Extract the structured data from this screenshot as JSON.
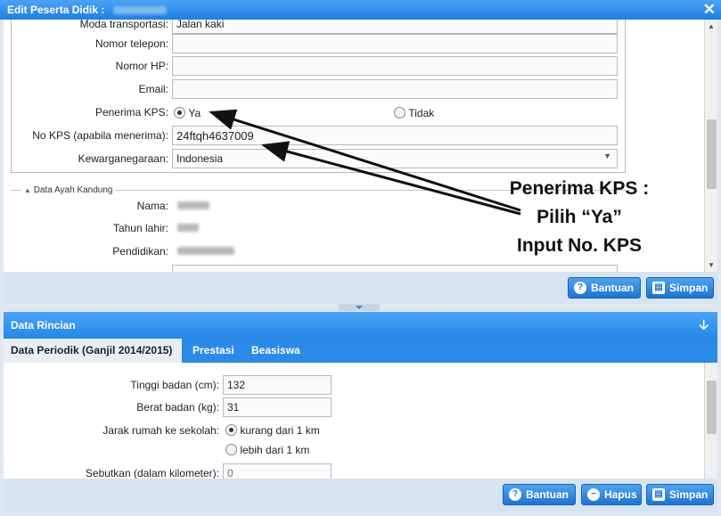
{
  "window": {
    "title": "Edit Peserta Didik :"
  },
  "form": {
    "moda_label": "Moda transportasi:",
    "moda_value": "Jalan kaki",
    "telepon_label": "Nomor telepon:",
    "hp_label": "Nomor HP:",
    "email_label": "Email:",
    "kps_label": "Penerima KPS:",
    "kps_yes": "Ya",
    "kps_no": "Tidak",
    "nokps_label": "No KPS (apabila menerima):",
    "nokps_value": "24ftqh4637009",
    "kewarganegaraan_label": "Kewarganegaraan:",
    "kewarganegaraan_value": "Indonesia"
  },
  "ayah": {
    "legend": "Data Ayah Kandung",
    "nama_label": "Nama:",
    "tahun_label": "Tahun lahir:",
    "pendidikan_label": "Pendidikan:"
  },
  "annotation": {
    "line1": "Penerima KPS :",
    "line2": "Pilih “Ya”",
    "line3": "Input No. KPS"
  },
  "toolbar_top": {
    "bantuan": "Bantuan",
    "simpan": "Simpan"
  },
  "rincian": {
    "title": "Data Rincian",
    "tabs": [
      "Data Periodik (Ganjil 2014/2015)",
      "Prestasi",
      "Beasiswa"
    ],
    "tinggi_label": "Tinggi badan (cm):",
    "tinggi_value": "132",
    "berat_label": "Berat badan (kg):",
    "berat_value": "31",
    "jarak_label": "Jarak rumah ke sekolah:",
    "jarak_opt1": "kurang dari 1 km",
    "jarak_opt2": "lebih dari 1 km",
    "sebutkan_label": "Sebutkan (dalam kilometer):",
    "sebutkan_placeholder": "0"
  },
  "toolbar_bottom": {
    "bantuan": "Bantuan",
    "hapus": "Hapus",
    "simpan": "Simpan"
  },
  "icons": [
    "close-icon",
    "help-icon",
    "save-icon",
    "delete-icon",
    "collapse-icon",
    "arrow-down-icon"
  ]
}
